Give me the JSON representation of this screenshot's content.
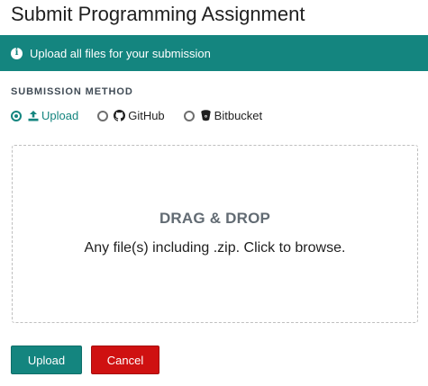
{
  "page": {
    "title": "Submit Programming Assignment"
  },
  "banner": {
    "icon": "info-circle-icon",
    "text": "Upload all files for your submission"
  },
  "submission": {
    "section_label": "SUBMISSION METHOD",
    "methods": [
      {
        "label": "Upload",
        "icon": "upload-icon",
        "selected": true
      },
      {
        "label": "GitHub",
        "icon": "github-icon",
        "selected": false
      },
      {
        "label": "Bitbucket",
        "icon": "bitbucket-icon",
        "selected": false
      }
    ]
  },
  "dropzone": {
    "title": "DRAG & DROP",
    "subtitle": "Any file(s) including .zip. Click to browse."
  },
  "actions": {
    "upload_label": "Upload",
    "cancel_label": "Cancel"
  },
  "colors": {
    "accent": "#14857f",
    "danger": "#cf1111"
  }
}
